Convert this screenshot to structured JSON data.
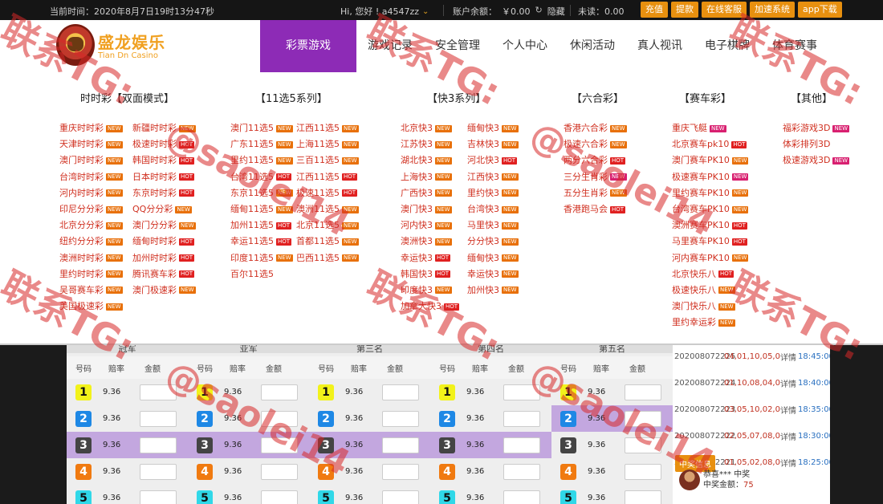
{
  "topbar": {
    "time_text": "当前时间：2020年8月7日19时13分47秒",
    "greeting": "Hi, 您好 ! a4547zz",
    "balance_label": "账户余额：",
    "balance_value": "￥0.00",
    "hide_label": "隐藏",
    "unread_label": "未读：0.00",
    "buttons": [
      "充值",
      "提款",
      "在线客服",
      "加速系统",
      "app下载"
    ]
  },
  "logo": {
    "cn": "盛龙娱乐",
    "en": "Tian Dn Casino"
  },
  "nav": {
    "items": [
      "彩票游戏",
      "游戏记录",
      "安全管理",
      "个人中心",
      "休闲活动",
      "真人视讯",
      "电子棋牌",
      "体育赛事"
    ],
    "active_index": 0
  },
  "menu": {
    "columns": [
      {
        "header": "时时彩【双面模式】",
        "games": [
          {
            "name": "重庆时时彩",
            "badge": "new"
          },
          {
            "name": "新疆时时彩",
            "badge": "new"
          },
          {
            "name": "天津时时彩",
            "badge": "new"
          },
          {
            "name": "极速时时彩",
            "badge": "hot"
          },
          {
            "name": "澳门时时彩",
            "badge": "new"
          },
          {
            "name": "韩国时时彩",
            "badge": "hot"
          },
          {
            "name": "台湾时时彩",
            "badge": "new"
          },
          {
            "name": "日本时时彩",
            "badge": "hot"
          },
          {
            "name": "河内时时彩",
            "badge": "new"
          },
          {
            "name": "东京时时彩",
            "badge": "hot"
          },
          {
            "name": "印尼分分彩",
            "badge": "new"
          },
          {
            "name": "QQ分分彩",
            "badge": "new"
          },
          {
            "name": "北京分分彩",
            "badge": "new"
          },
          {
            "name": "澳门分分彩",
            "badge": "new"
          },
          {
            "name": "纽约分分彩",
            "badge": "new"
          },
          {
            "name": "缅甸时时彩",
            "badge": "hot"
          },
          {
            "name": "澳洲时时彩",
            "badge": "new"
          },
          {
            "name": "加州时时彩",
            "badge": "hot"
          },
          {
            "name": "里约时时彩",
            "badge": "new"
          },
          {
            "name": "腾讯赛车彩",
            "badge": "hot"
          },
          {
            "name": "吴哥赛车彩",
            "badge": "new"
          },
          {
            "name": "澳门极速彩",
            "badge": "new"
          },
          {
            "name": "美国极速彩",
            "badge": "new"
          }
        ]
      },
      {
        "header": "【11选5系列】",
        "games": [
          {
            "name": "澳门11选5",
            "badge": "new"
          },
          {
            "name": "江西11选5",
            "badge": "new"
          },
          {
            "name": "广东11选5",
            "badge": "new"
          },
          {
            "name": "上海11选5",
            "badge": "new"
          },
          {
            "name": "里约11选5",
            "badge": "new"
          },
          {
            "name": "三百11选5",
            "badge": "new"
          },
          {
            "name": "台湾11选5",
            "badge": "hot"
          },
          {
            "name": "江西11选5",
            "badge": "hot"
          },
          {
            "name": "东京11选5",
            "badge": "new"
          },
          {
            "name": "极速11选5",
            "badge": "hot"
          },
          {
            "name": "缅甸11选5",
            "badge": "new"
          },
          {
            "name": "澳洲11选5",
            "badge": "new"
          },
          {
            "name": "加州11选5",
            "badge": "hot"
          },
          {
            "name": "北京11选5",
            "badge": "new"
          },
          {
            "name": "幸运11选5",
            "badge": "hot"
          },
          {
            "name": "首都11选5",
            "badge": "new"
          },
          {
            "name": "印度11选5",
            "badge": "new"
          },
          {
            "name": "巴西11选5",
            "badge": "new"
          },
          {
            "name": "百尔11选5",
            "badge": ""
          }
        ]
      },
      {
        "header": "【快3系列】",
        "games": [
          {
            "name": "北京快3",
            "badge": "new"
          },
          {
            "name": "缅甸快3",
            "badge": "new"
          },
          {
            "name": "江苏快3",
            "badge": "new"
          },
          {
            "name": "吉林快3",
            "badge": "new"
          },
          {
            "name": "湖北快3",
            "badge": "new"
          },
          {
            "name": "河北快3",
            "badge": "hot"
          },
          {
            "name": "上海快3",
            "badge": "new"
          },
          {
            "name": "江西快3",
            "badge": "new"
          },
          {
            "name": "广西快3",
            "badge": "new"
          },
          {
            "name": "里约快3",
            "badge": "new"
          },
          {
            "name": "澳门快3",
            "badge": "new"
          },
          {
            "name": "台湾快3",
            "badge": "new"
          },
          {
            "name": "河内快3",
            "badge": "new"
          },
          {
            "name": "马里快3",
            "badge": "new"
          },
          {
            "name": "澳洲快3",
            "badge": "new"
          },
          {
            "name": "分分快3",
            "badge": "new"
          },
          {
            "name": "幸运快3",
            "badge": "hot"
          },
          {
            "name": "缅甸快3",
            "badge": "new"
          },
          {
            "name": "韩国快3",
            "badge": "hot"
          },
          {
            "name": "幸运快3",
            "badge": "new"
          },
          {
            "name": "印度快3",
            "badge": "new"
          },
          {
            "name": "加州快3",
            "badge": "new"
          },
          {
            "name": "加拿大快3",
            "badge": "hot"
          }
        ]
      },
      {
        "header": "【六合彩】",
        "games": [
          {
            "name": "香港六合彩",
            "badge": "new"
          },
          {
            "name": "极速六合彩",
            "badge": "new"
          },
          {
            "name": "两分六合彩",
            "badge": "hot"
          },
          {
            "name": "三分生肖彩",
            "badge": "pink"
          },
          {
            "name": "五分生肖彩",
            "badge": "new"
          },
          {
            "name": "香港跑马会",
            "badge": "hot"
          }
        ]
      },
      {
        "header": "【赛车彩】",
        "games": [
          {
            "name": "重庆飞艇",
            "badge": "pink"
          },
          {
            "name": "北京赛车pk10",
            "badge": "hot"
          },
          {
            "name": "澳门赛车PK10",
            "badge": "new"
          },
          {
            "name": "极速赛车PK10",
            "badge": "pink"
          },
          {
            "name": "里约赛车PK10",
            "badge": "new"
          },
          {
            "name": "台湾赛车PK10",
            "badge": "new"
          },
          {
            "name": "澳洲赛车PK10",
            "badge": "hot"
          },
          {
            "name": "马里赛车PK10",
            "badge": "hot"
          },
          {
            "name": "河内赛车PK10",
            "badge": "new"
          },
          {
            "name": "北京快乐八",
            "badge": "hot"
          },
          {
            "name": "极速快乐八",
            "badge": "new"
          },
          {
            "name": "澳门快乐八",
            "badge": "new"
          },
          {
            "name": "里约幸运彩",
            "badge": "new"
          }
        ]
      },
      {
        "header": "【其他】",
        "games": [
          {
            "name": "福彩游戏3D",
            "badge": "pink"
          },
          {
            "name": "体彩排列3D",
            "badge": ""
          },
          {
            "name": "极速游戏3D",
            "badge": "pink"
          }
        ]
      }
    ]
  },
  "board": {
    "groups": [
      "冠军",
      "亚军",
      "第三名",
      "第四名",
      "第五名"
    ],
    "headers": {
      "num": "号码",
      "odds": "赔率",
      "amount": "金额"
    },
    "rows": [
      {
        "num": "1",
        "odds": "9.36"
      },
      {
        "num": "2",
        "odds": "9.36"
      },
      {
        "num": "3",
        "odds": "9.36"
      },
      {
        "num": "4",
        "odds": "9.36"
      },
      {
        "num": "5",
        "odds": "9.36"
      }
    ]
  },
  "results": [
    {
      "id": "202008072225",
      "nums": "04,01,10,05,0…",
      "name": "详情",
      "time": "18:45:00"
    },
    {
      "id": "202008072224",
      "nums": "01,10,08,04,0…",
      "name": "详情",
      "time": "18:40:00"
    },
    {
      "id": "202008072223",
      "nums": "03,05,10,02,0…",
      "name": "详情",
      "time": "18:35:00"
    },
    {
      "id": "202008072222",
      "nums": "02,05,07,08,0…",
      "name": "详情",
      "time": "18:30:00"
    },
    {
      "id": "202008072221",
      "nums": "01,05,02,08,0…",
      "name": "详情",
      "time": "18:25:00"
    }
  ],
  "winners": {
    "tag": "中奖信息",
    "name": "恭喜*** 中奖",
    "amount_label": "中奖金额：",
    "amount": "75"
  },
  "watermark": {
    "line": "联系TG:",
    "handle": "@saolei14"
  }
}
